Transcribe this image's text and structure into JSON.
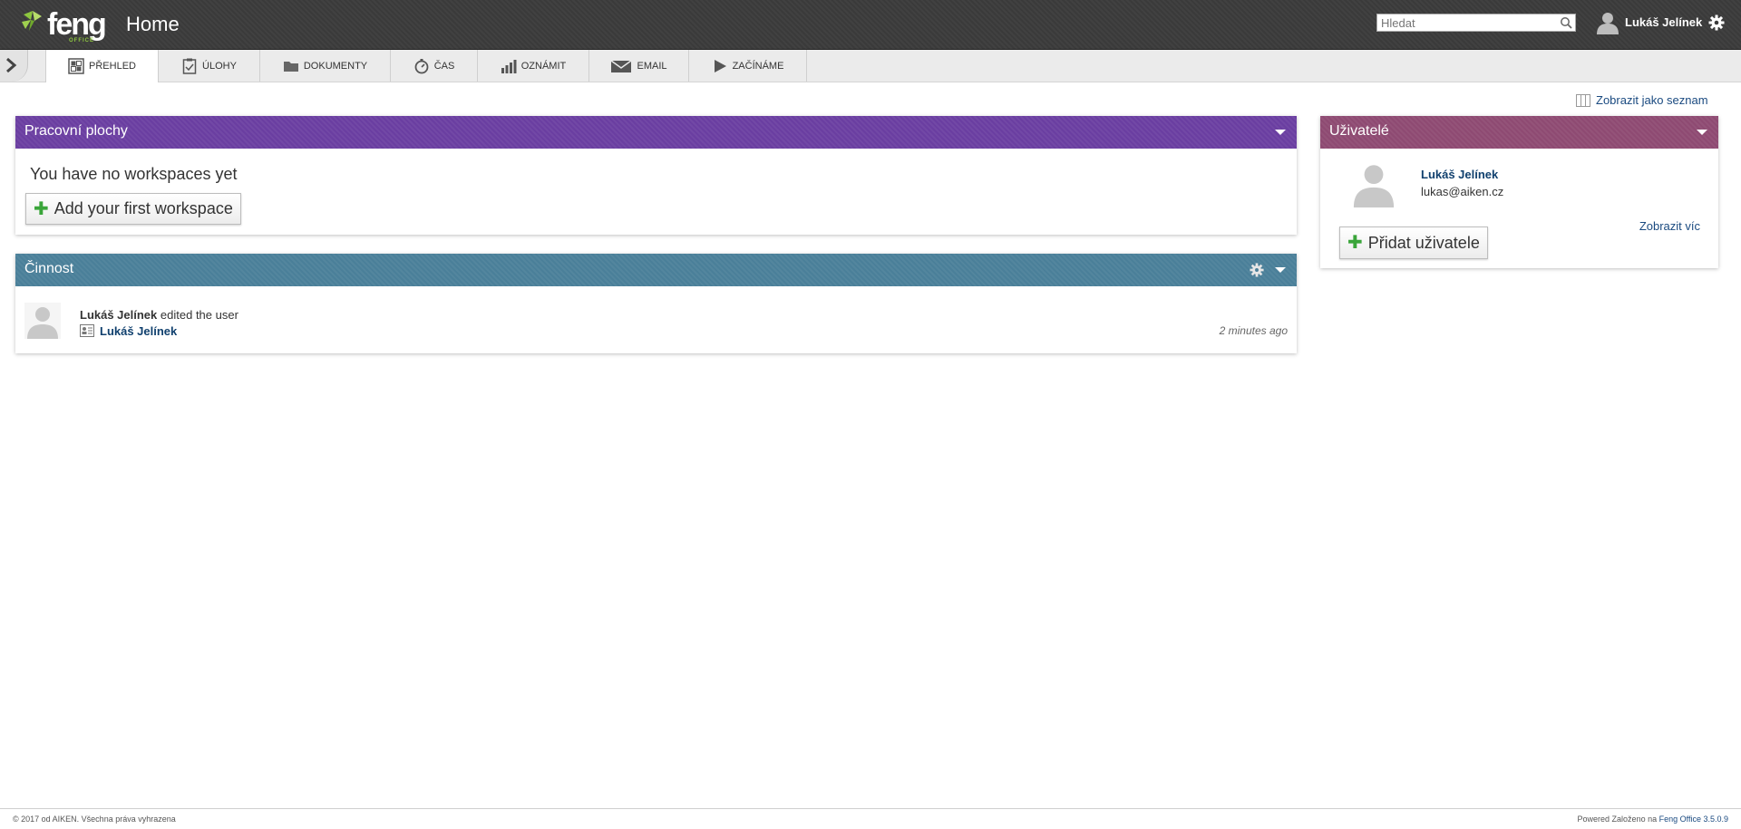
{
  "header": {
    "logo_text": "feng",
    "logo_sub": "OFFICE",
    "title": "Home",
    "search_placeholder": "Hledat",
    "user_name": "Lukáš Jelínek"
  },
  "tabs": [
    {
      "label": "PŘEHLED",
      "icon": "dashboard-icon",
      "active": true
    },
    {
      "label": "ÚLOHY",
      "icon": "task-list-icon"
    },
    {
      "label": "DOKUMENTY",
      "icon": "folder-icon"
    },
    {
      "label": "ČAS",
      "icon": "stopwatch-icon"
    },
    {
      "label": "OZNÁMIT",
      "icon": "bar-chart-icon"
    },
    {
      "label": "EMAIL",
      "icon": "envelope-icon"
    },
    {
      "label": "ZAČÍNÁME",
      "icon": "play-icon"
    }
  ],
  "view_as_list": "Zobrazit jako seznam",
  "workspaces": {
    "title": "Pracovní plochy",
    "empty_text": "You have no workspaces yet",
    "add_button": "Add your first workspace",
    "header_color": "#6a3ea1"
  },
  "activity": {
    "title": "Činnost",
    "header_color": "#4a7f99",
    "items": [
      {
        "actor": "Lukáš Jelínek",
        "action": "edited the user",
        "object": "Lukáš Jelínek",
        "time": "2 minutes ago"
      }
    ]
  },
  "users": {
    "title": "Uživatelé",
    "header_color": "#8e4a72",
    "user_name": "Lukáš Jelínek",
    "user_email": "lukas@aiken.cz",
    "show_more": "Zobrazit víc",
    "add_button": "Přidat uživatele"
  },
  "footer": {
    "left": "© 2017 od AIKEN. Všechna práva vyhrazena",
    "right_prefix": "Powered Založeno na",
    "right_link": "Feng Office 3.5.0.9"
  }
}
